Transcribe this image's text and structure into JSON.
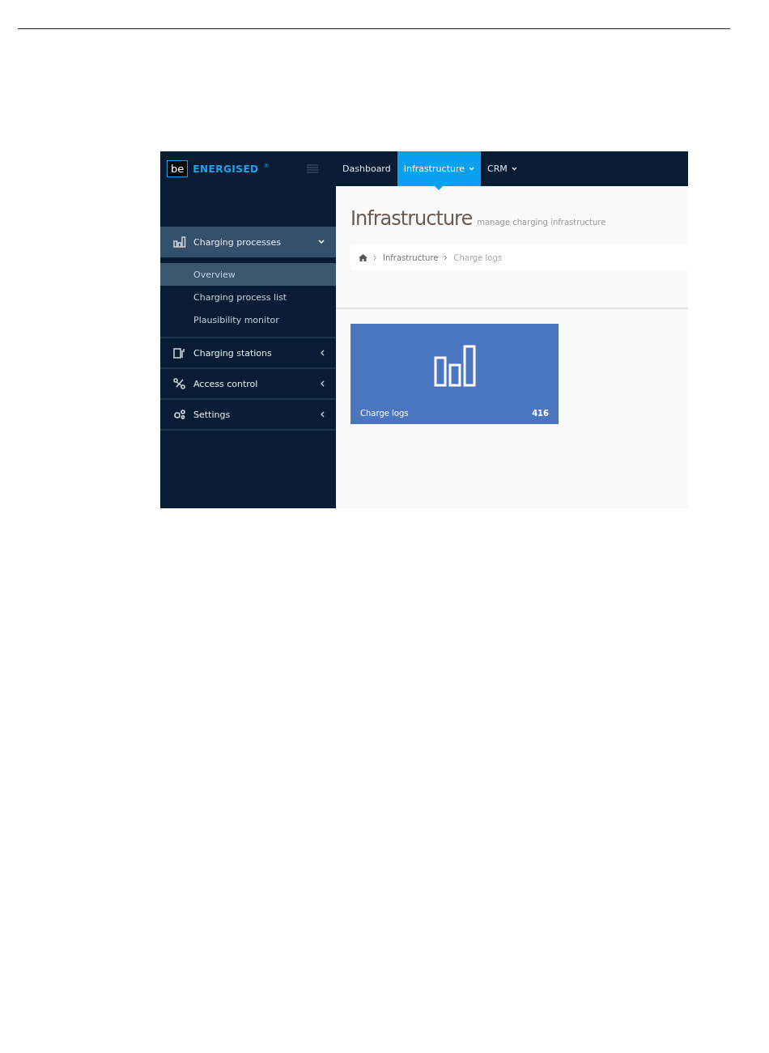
{
  "logo": {
    "mark": "be",
    "name": "ENERGISED",
    "symbol": "®"
  },
  "top_nav": [
    {
      "label": "Dashboard",
      "selected": false,
      "dropdown": false
    },
    {
      "label": "Infrastructure",
      "selected": true,
      "dropdown": true
    },
    {
      "label": "CRM",
      "selected": false,
      "dropdown": true
    }
  ],
  "sidebar": {
    "items": [
      {
        "label": "Charging processes",
        "selected": true,
        "expanded": true,
        "children": [
          {
            "label": "Overview",
            "selected": true
          },
          {
            "label": "Charging process list",
            "selected": false
          },
          {
            "label": "Plausibility monitor",
            "selected": false
          }
        ]
      },
      {
        "label": "Charging stations",
        "selected": false,
        "expanded": false
      },
      {
        "label": "Access control",
        "selected": false,
        "expanded": false
      },
      {
        "label": "Settings",
        "selected": false,
        "expanded": false
      }
    ]
  },
  "page": {
    "title": "Infrastructure",
    "subtitle": "manage charging infrastructure"
  },
  "breadcrumb": [
    "Infrastructure",
    "Charge logs"
  ],
  "tiles": [
    {
      "label": "Charge logs",
      "count": "416"
    }
  ]
}
